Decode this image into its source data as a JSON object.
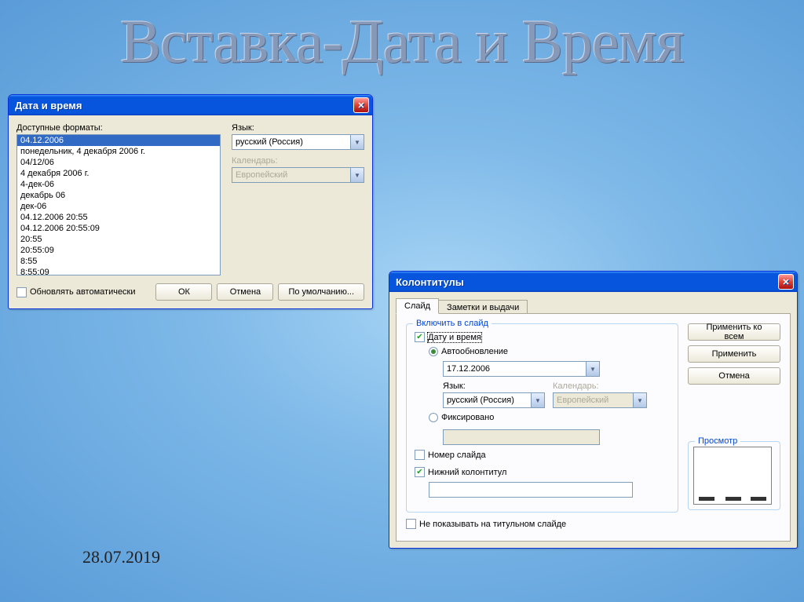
{
  "slide": {
    "title": "Вставка-Дата и Время",
    "footer_date": "28.07.2019"
  },
  "dlg1": {
    "title": "Дата и время",
    "formats_label": "Доступные форматы:",
    "formats": [
      "04.12.2006",
      "понедельник, 4 декабря 2006 г.",
      "04/12/06",
      "4 декабря 2006 г.",
      "4-дек-06",
      "декабрь 06",
      "дек-06",
      "04.12.2006 20:55",
      "04.12.2006 20:55:09",
      "20:55",
      "20:55:09",
      "8:55",
      "8:55:09"
    ],
    "lang_label": "Язык:",
    "lang_value": "русский (Россия)",
    "calendar_label": "Календарь:",
    "calendar_value": "Европейский",
    "auto_update": "Обновлять автоматически",
    "ok": "ОК",
    "cancel": "Отмена",
    "default": "По умолчанию..."
  },
  "dlg2": {
    "title": "Колонтитулы",
    "tab_slide": "Слайд",
    "tab_notes": "Заметки и выдачи",
    "fs_include": "Включить в слайд",
    "cb_datetime": "Дату и время",
    "rb_auto": "Автообновление",
    "date_value": "17.12.2006",
    "lang_label": "Язык:",
    "lang_value": "русский (Россия)",
    "calendar_label": "Календарь:",
    "calendar_value": "Европейский",
    "rb_fixed": "Фиксировано",
    "cb_slidenum": "Номер слайда",
    "cb_footer": "Нижний колонтитул",
    "cb_nottitle": "Не показывать на титульном слайде",
    "btn_applyall": "Применить ко всем",
    "btn_apply": "Применить",
    "btn_cancel": "Отмена",
    "preview": "Просмотр"
  }
}
